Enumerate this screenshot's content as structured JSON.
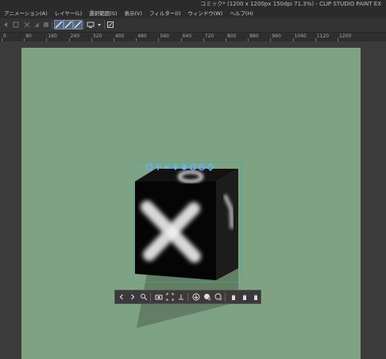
{
  "window": {
    "title": "コミック* (1200 x 1200px 150dpi 71.3%)  - CLIP STUDIO PAINT EX"
  },
  "menu": {
    "items": [
      {
        "label": "アニメーション(A)"
      },
      {
        "label": "レイヤー(L)"
      },
      {
        "label": "選択範囲(S)"
      },
      {
        "label": "表示(V)"
      },
      {
        "label": "フィルター(I)"
      },
      {
        "label": "ウィンドウ(W)"
      },
      {
        "label": "ヘルプ(H)"
      }
    ]
  },
  "ruler": {
    "labels": [
      "0",
      "80",
      "160",
      "240",
      "320",
      "400",
      "480",
      "560",
      "640",
      "720",
      "800",
      "880",
      "960",
      "1040",
      "1120",
      "1200"
    ]
  },
  "colors": {
    "canvas_background": "#7fa282",
    "workspace_background": "#3b3b3b",
    "accent_active": "#52657e"
  },
  "toolbar": {
    "icons": [
      "undo-icon",
      "redo-icon",
      "clear-icon",
      "transform-icon",
      "fill-icon",
      "stabilizer-icon",
      "pen-a-icon",
      "pen-b-icon",
      "pen-c-icon",
      "screen-icon",
      "dropdown-icon",
      "edit-icon"
    ]
  },
  "cube_floating_toolbar": {
    "icons": [
      "prev-icon",
      "next-icon",
      "edit-camera-icon",
      "camera-icon",
      "fit-icon",
      "ground-icon",
      "download-icon",
      "add-object-icon",
      "add-pose-icon",
      "hand-a-icon",
      "hand-b-icon",
      "hand-c-icon"
    ]
  },
  "gizmo": {
    "icons": [
      "rotate-camera-icon",
      "pan-camera-icon",
      "zoom-camera-icon",
      "move-object-icon",
      "rotate-object-icon",
      "rotate-screen-icon",
      "scale-object-icon",
      "snap-icon"
    ]
  }
}
